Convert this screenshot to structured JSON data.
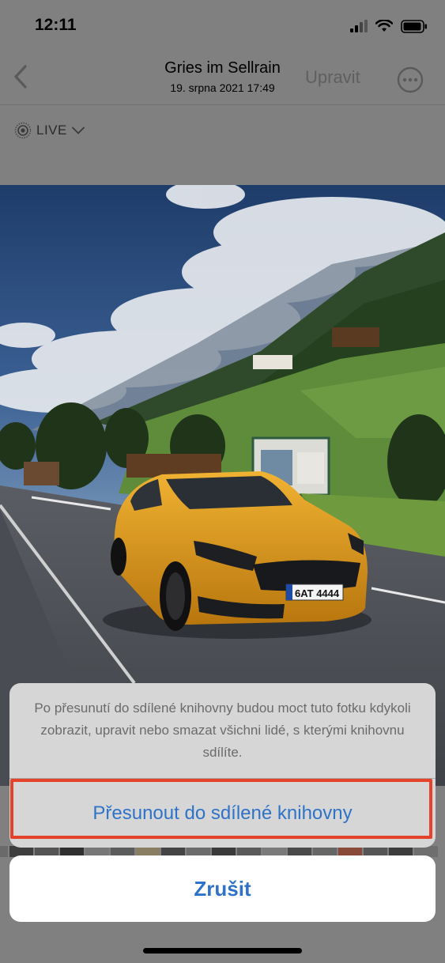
{
  "status_bar": {
    "time": "12:11",
    "icons": [
      "signal-icon",
      "wifi-icon",
      "battery-icon"
    ]
  },
  "nav": {
    "title": "Gries im Sellrain",
    "subtitle": "19. srpna 2021  17:49",
    "edit_label": "Upravit",
    "back_icon": "chevron-left-icon",
    "more_icon": "ellipsis-circle-icon"
  },
  "live": {
    "label": "LIVE",
    "icon": "live-photo-icon",
    "chevron": "chevron-down-icon"
  },
  "action_sheet": {
    "message": "Po přesunutí do sdílené knihovny budou moct tuto fotku kdykoli zobrazit, upravit nebo smazat všichni lidé, s kterými knihovnu sdílíte.",
    "move_label": "Přesunout do sdílené knihovny",
    "cancel_label": "Zrušit"
  },
  "colors": {
    "accent": "#2f73c9",
    "highlight": "#e4432a",
    "car": "#e9a520"
  }
}
